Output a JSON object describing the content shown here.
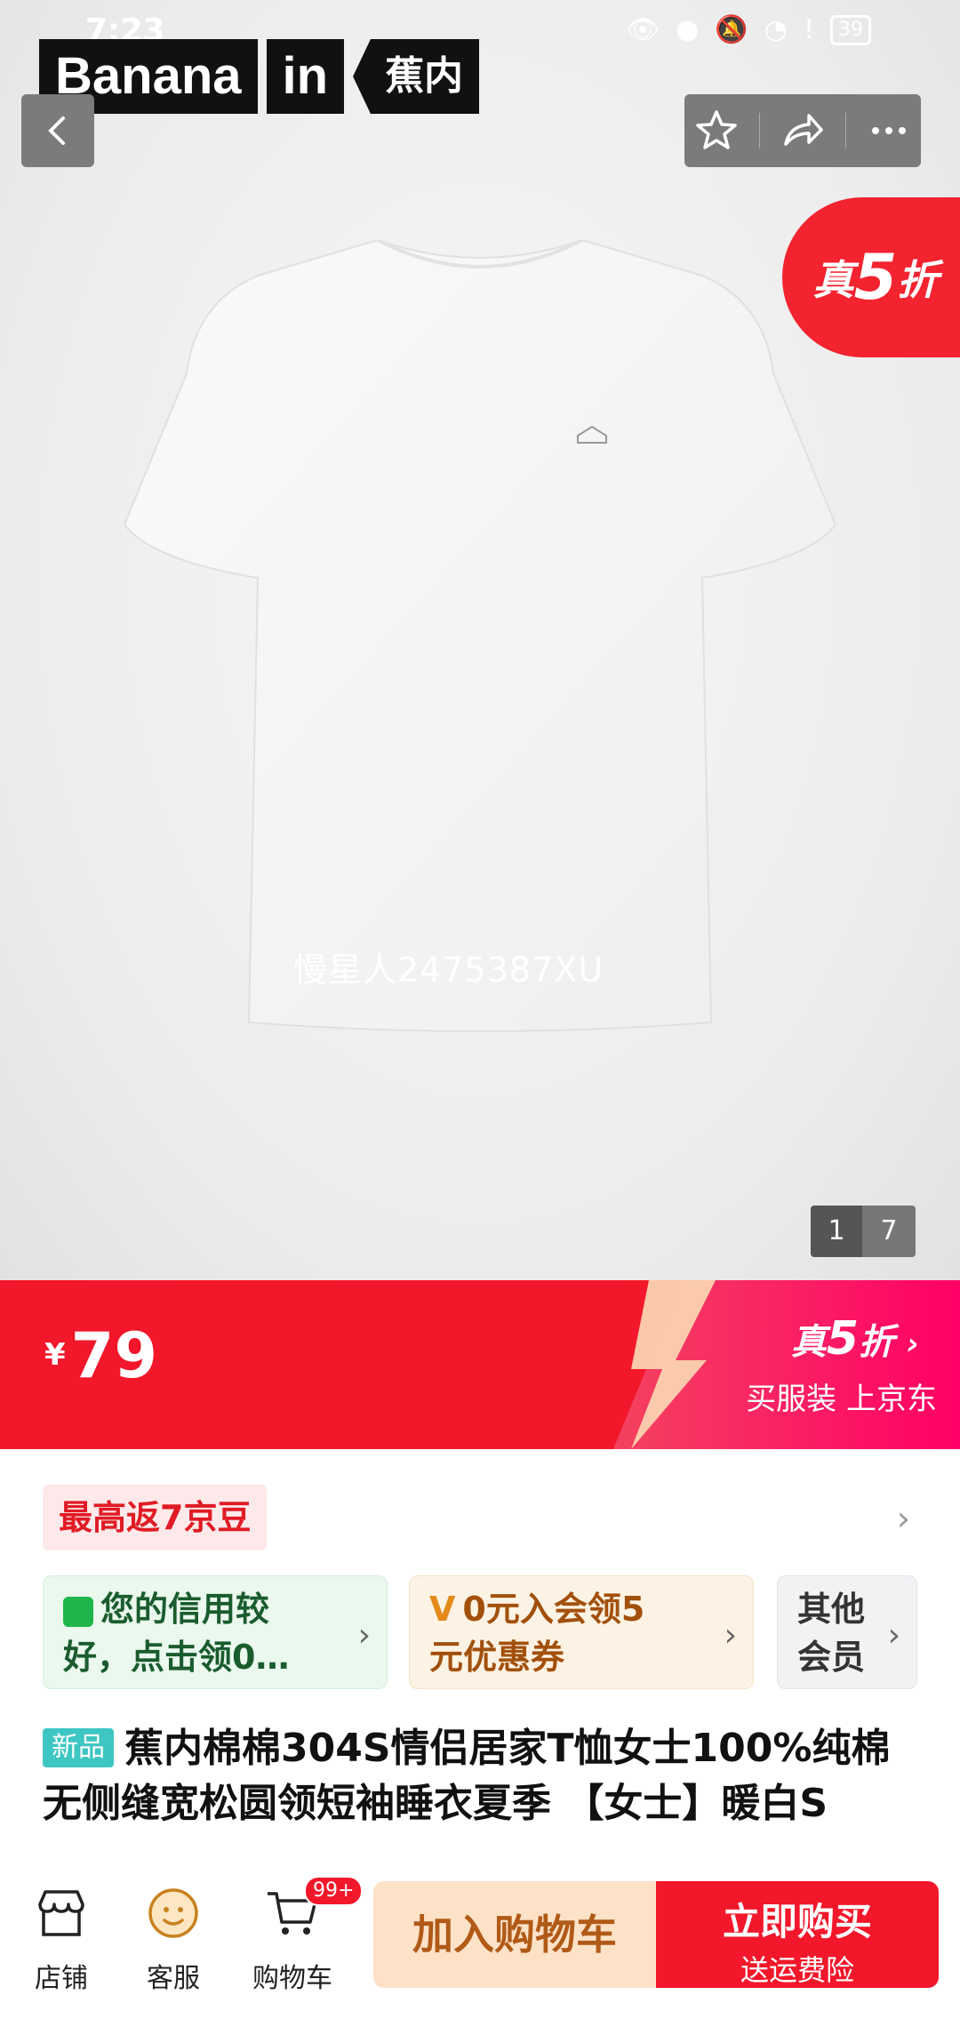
{
  "status_bar": {
    "time": "7:23",
    "battery": "39"
  },
  "brand": {
    "part1": "Banana",
    "part2": "in",
    "part3": "蕉内"
  },
  "promo_badge": {
    "prefix": "真",
    "number": "5",
    "suffix": "折"
  },
  "image": {
    "watermark": "慢星人2475387XU",
    "page_current": "1",
    "page_total": "7"
  },
  "price_bar": {
    "currency": "¥",
    "price": "79",
    "promo_prefix": "真",
    "promo_number": "5",
    "promo_suffix": "折",
    "promo_arrow": "›",
    "promo_sub": "买服装 上京东"
  },
  "coupon": {
    "label": "最高返7京豆",
    "chevron": "›"
  },
  "cards": {
    "credit": {
      "line1": "您的信用较",
      "line2": "好，点击领0…",
      "arrow": "›"
    },
    "member": {
      "line1": "0元入会领5",
      "line2": "元优惠券",
      "icon": "V",
      "arrow": "›"
    },
    "other": {
      "line1": "其他",
      "line2": "会员",
      "arrow": "›"
    }
  },
  "product": {
    "tag": "新品",
    "title": "蕉内棉棉304S情侣居家T恤女士100%纯棉无侧缝宽松圆领短袖睡衣夏季 【女士】暖白S"
  },
  "bottom_bar": {
    "shop": "店铺",
    "service": "客服",
    "cart": "购物车",
    "cart_badge": "99+",
    "add_to_cart": "加入购物车",
    "buy_now": "立即购买",
    "buy_now_sub": "送运费险"
  },
  "colors": {
    "accent_red": "#f2172a",
    "hero_bg": "#ececec"
  }
}
